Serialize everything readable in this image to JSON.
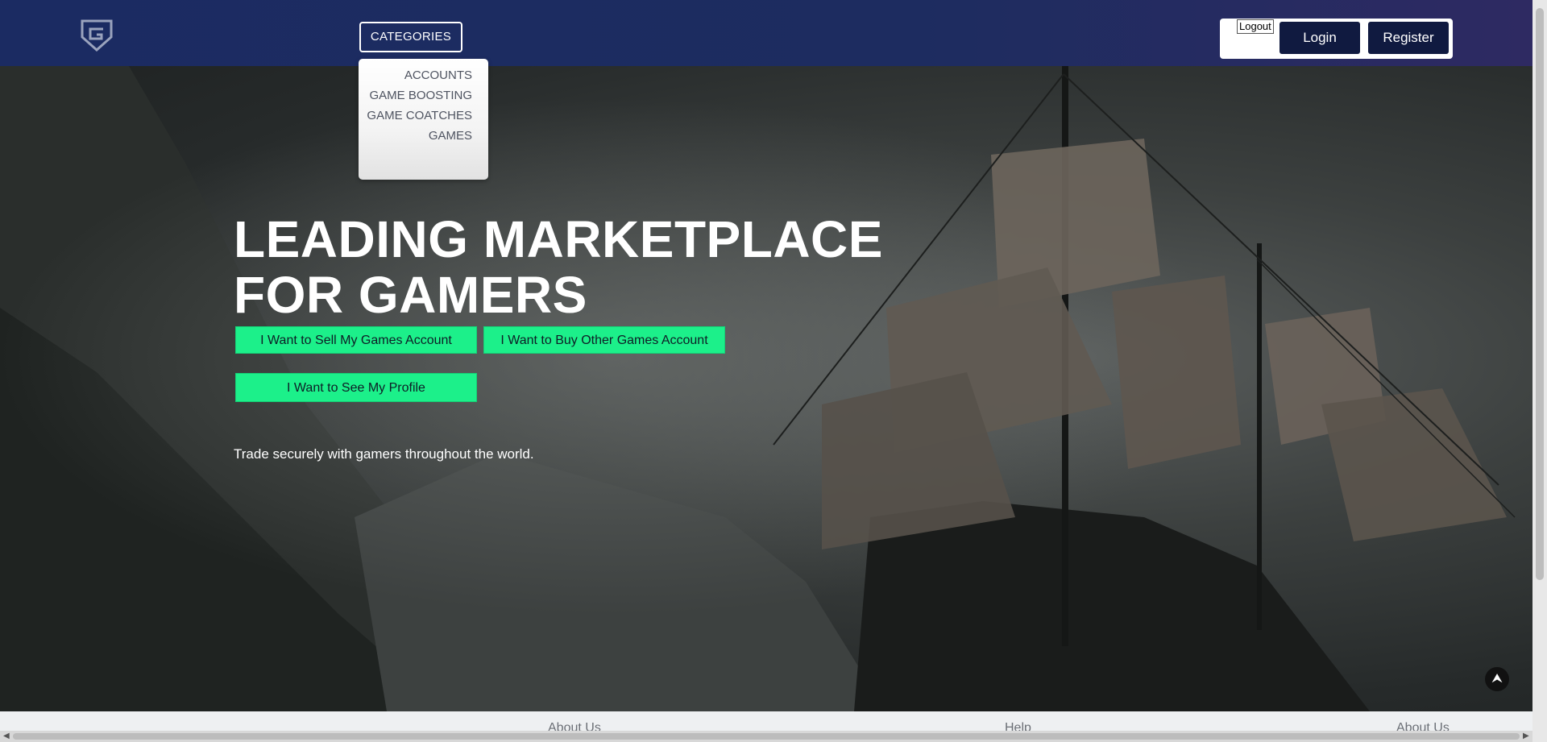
{
  "header": {
    "logo_icon": "gamer-shield-logo-icon",
    "categories_label": "CATEGORIES",
    "logout_label": "Logout",
    "login_label": "Login",
    "register_label": "Register"
  },
  "dropdown": {
    "items": [
      {
        "label": "ACCOUNTS"
      },
      {
        "label": "GAME BOOSTING"
      },
      {
        "label": "GAME COATCHES"
      },
      {
        "label": "GAMES"
      }
    ]
  },
  "hero": {
    "headline_line1": "LEADING MARKETPLACE",
    "headline_line2": "FOR GAMERS",
    "sell_button": "I Want to Sell My Games Account",
    "buy_button": "I Want to Buy Other Games Account",
    "profile_button": "I Want to See My Profile",
    "tagline": "Trade securely with gamers throughout the world."
  },
  "scroll_top_icon": "arrow-up-icon",
  "footer": {
    "links": [
      {
        "label": "About Us"
      },
      {
        "label": "Help"
      },
      {
        "label": "About Us"
      }
    ]
  },
  "colors": {
    "header_bg": "#1b2b62",
    "cta_green": "#1cf08a",
    "auth_button_bg": "#101a40"
  }
}
